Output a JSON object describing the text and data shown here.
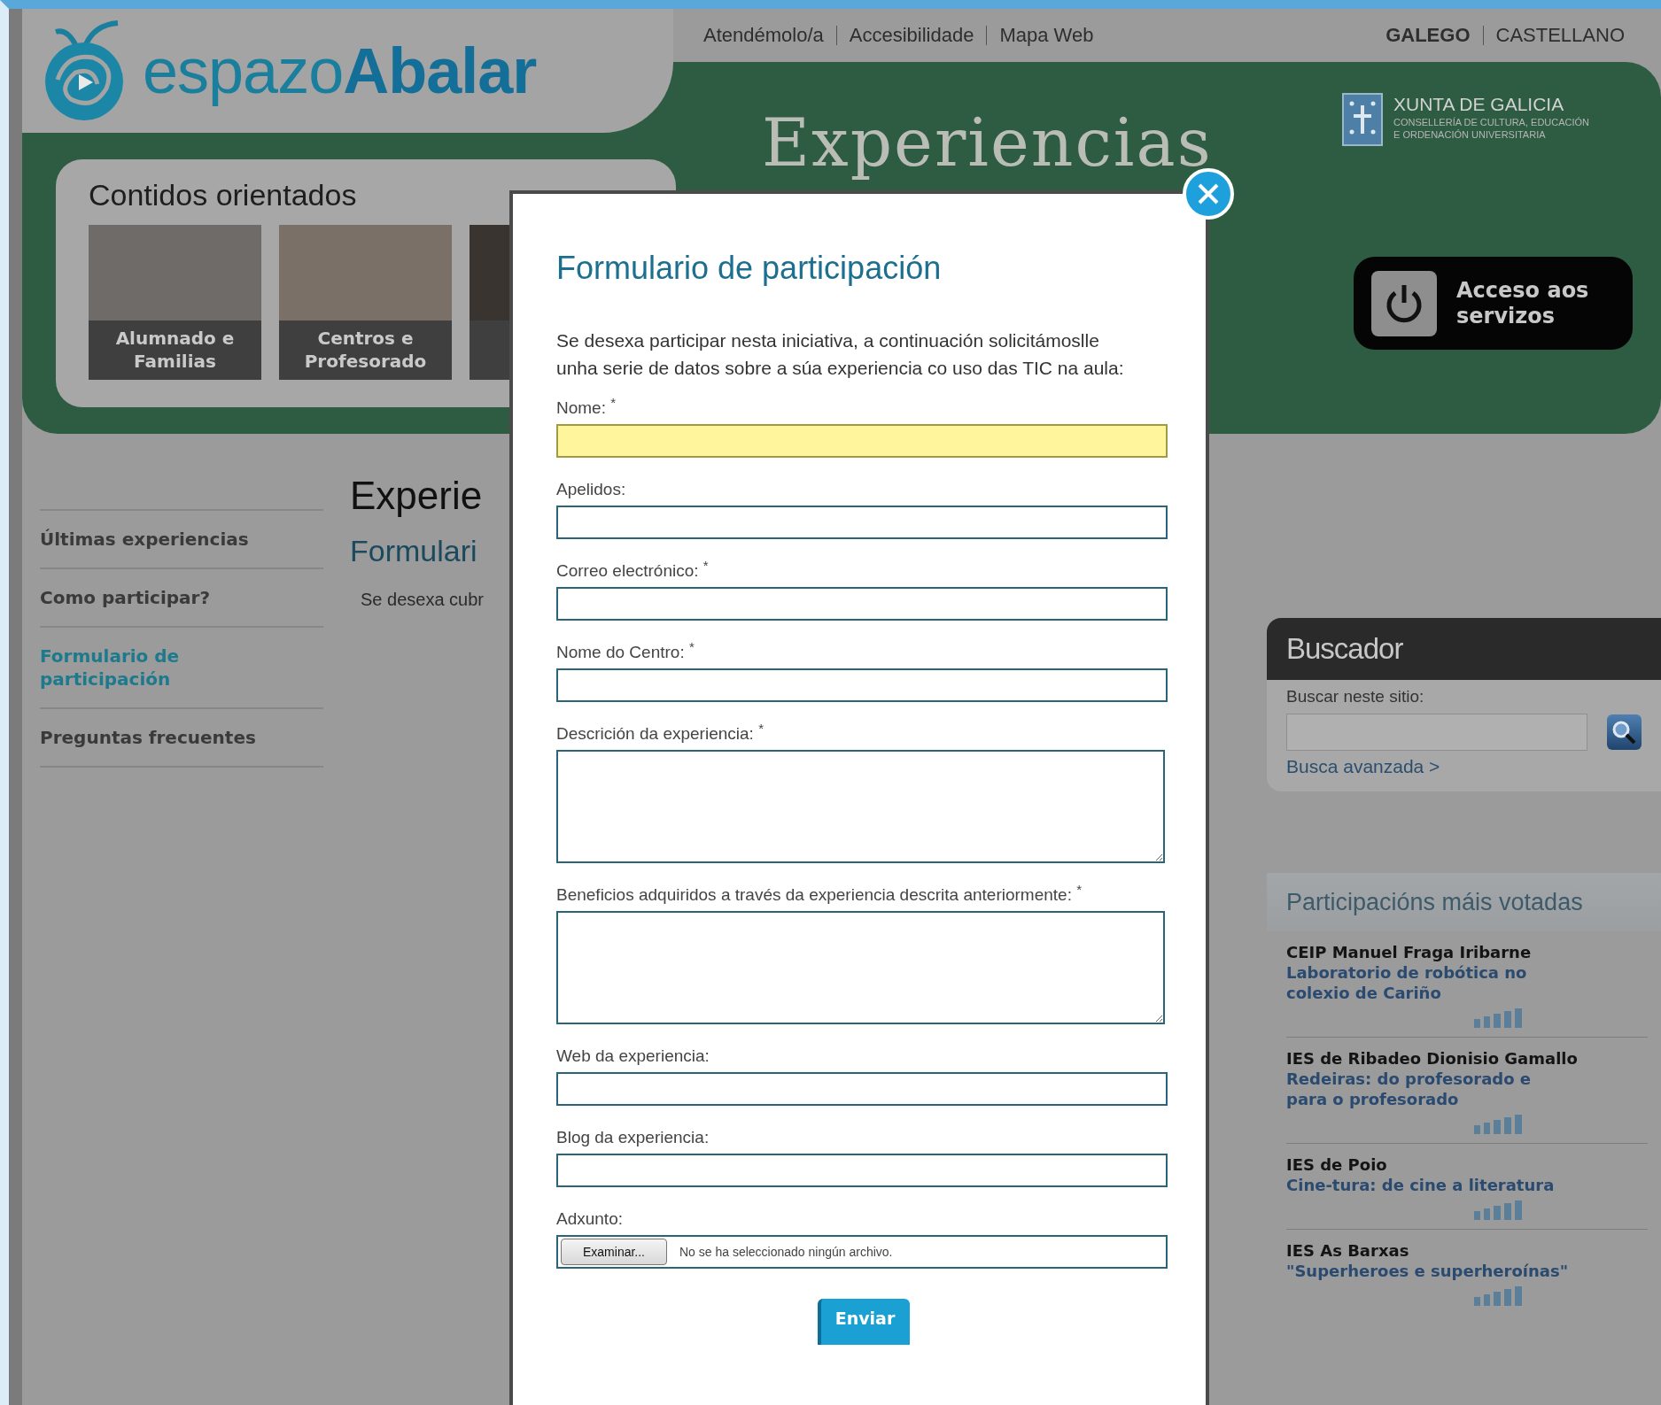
{
  "header": {
    "logo": "espazo**Abalar**",
    "top_links": [
      "Atendémolo/a",
      "Accesibilidade",
      "Mapa Web"
    ],
    "languages": [
      {
        "label": "GALEGO",
        "selected": true
      },
      {
        "label": "CASTELLANO",
        "selected": false
      }
    ]
  },
  "banner": {
    "panel_title": "Contidos orientados",
    "tiles": [
      {
        "label": "Alumnado e Familias"
      },
      {
        "label": "Centros e Profesorado"
      }
    ],
    "title": "Experiencias",
    "government": {
      "name": "XUNTA DE GALICIA",
      "department_lines": [
        "CONSELLERÍA DE CULTURA, EDUCACIÓN",
        "E ORDENACIÓN UNIVERSITARIA"
      ]
    },
    "access_button": "Acceso aos servizos"
  },
  "sidebar": {
    "items": [
      {
        "label": "Últimas experiencias",
        "selected": false
      },
      {
        "label": "Como participar?",
        "selected": false
      },
      {
        "label": "Formulario de participación",
        "selected": true
      },
      {
        "label": "Preguntas frecuentes",
        "selected": false
      }
    ]
  },
  "main": {
    "heading": "Experie",
    "subheading": "Formulari",
    "text": "Se desexa cubr"
  },
  "search": {
    "title": "Buscador",
    "label": "Buscar neste sitio:",
    "advanced_link": "Busca avanzada >"
  },
  "top_voted": {
    "title": "Participacións máis votadas",
    "items": [
      {
        "school": "CEIP Manuel Fraga Iribarne",
        "title": "Laboratorio de robótica no colexio de Cariño"
      },
      {
        "school": "IES de Ribadeo Dionisio Gamallo",
        "title": "Redeiras: do profesorado e para o profesorado"
      },
      {
        "school": "IES de Poio",
        "title": "Cine-tura: de cine a literatura"
      },
      {
        "school": "IES As Barxas",
        "title": "\"Superheroes e superheroínas\""
      }
    ]
  },
  "modal": {
    "title": "Formulario de participación",
    "intro": "Se desexa participar nesta iniciativa, a continuación solicitámoslle unha serie de datos sobre a súa experiencia co uso das TIC na aula:",
    "fields": [
      {
        "kind": "text",
        "label": "Nome: $^{*}$",
        "focused": true
      },
      {
        "kind": "text",
        "label": "Apelidos:",
        "focused": false
      },
      {
        "kind": "text",
        "label": "Correo electrónico: $^{*}$",
        "focused": false
      },
      {
        "kind": "text",
        "label": "Nome do Centro: $^{*}$",
        "focused": false
      },
      {
        "kind": "textarea",
        "label": "Descrición da experiencia: $^{*}$"
      },
      {
        "kind": "textarea",
        "label": "Beneficios adquiridos a través da experiencia descrita anteriormente: $^{*}$"
      },
      {
        "kind": "text",
        "label": "Web da experiencia:",
        "focused": false
      },
      {
        "kind": "text",
        "label": "Blog da experiencia:",
        "focused": false
      },
      {
        "kind": "file",
        "label": "Adxunto:",
        "button": "Examinar...",
        "status": "No se ha seleccionado ningún archivo."
      }
    ],
    "submit": "Enviar"
  }
}
